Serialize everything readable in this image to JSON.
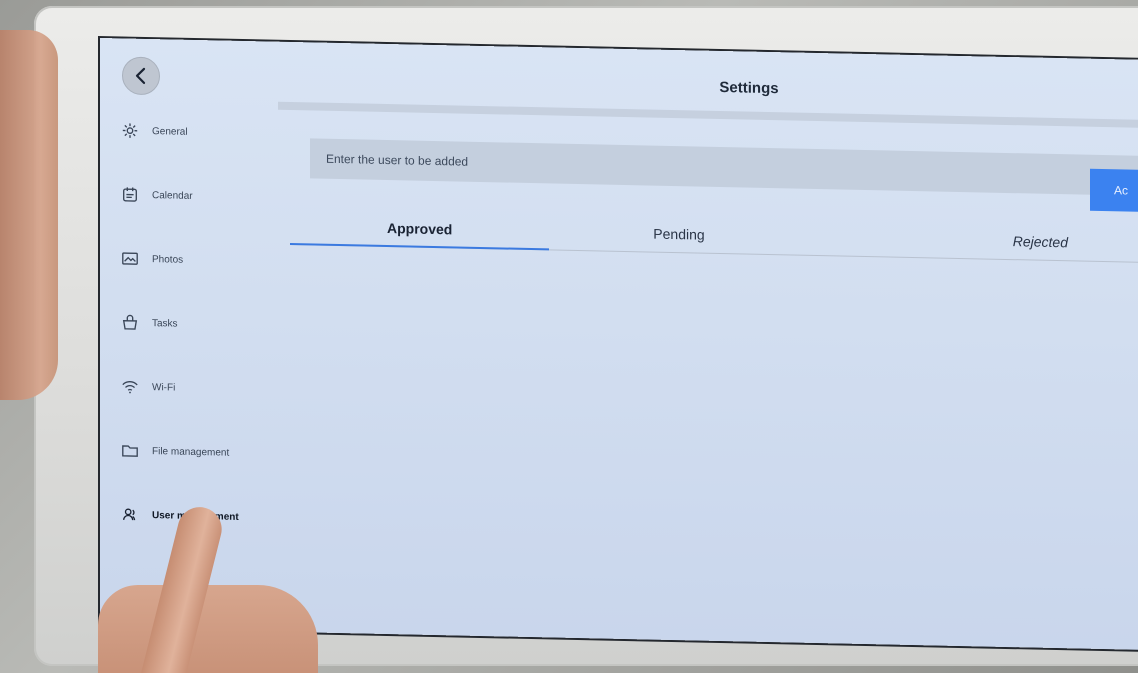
{
  "header": {
    "title": "Settings"
  },
  "sidebar": {
    "items": [
      {
        "label": "General",
        "icon": "gear-icon"
      },
      {
        "label": "Calendar",
        "icon": "calendar-icon"
      },
      {
        "label": "Photos",
        "icon": "photo-icon"
      },
      {
        "label": "Tasks",
        "icon": "basket-icon"
      },
      {
        "label": "Wi-Fi",
        "icon": "wifi-icon"
      },
      {
        "label": "File management",
        "icon": "folder-icon"
      },
      {
        "label": "User management",
        "icon": "users-icon"
      }
    ],
    "active_index": 6
  },
  "add_user": {
    "placeholder": "Enter the user to be added",
    "button_label": "Ac"
  },
  "tabs": [
    {
      "label": "Approved"
    },
    {
      "label": "Pending"
    },
    {
      "label": "Rejected"
    }
  ],
  "active_tab": 0,
  "colors": {
    "accent": "#3b82f0",
    "screen_background": "#d2def0"
  }
}
